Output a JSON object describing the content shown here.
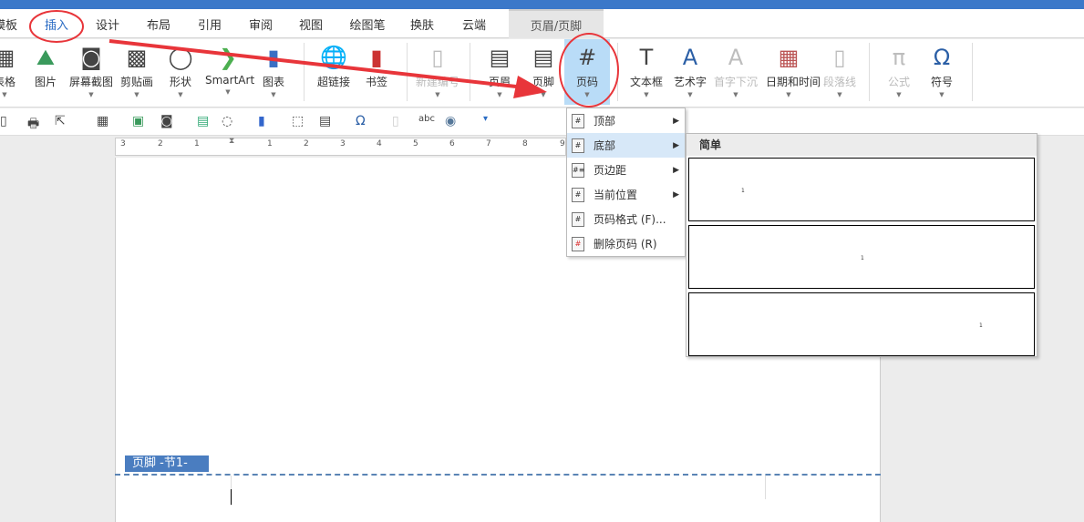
{
  "tabs": [
    "模板",
    "插入",
    "设计",
    "布局",
    "引用",
    "审阅",
    "视图",
    "绘图笔",
    "换肤",
    "云端"
  ],
  "context_tab": "页眉/页脚",
  "ribbon": [
    {
      "label": "表格",
      "icon": "table-icon"
    },
    {
      "label": "图片",
      "icon": "picture-icon"
    },
    {
      "label": "屏幕截图",
      "icon": "screenshot-icon"
    },
    {
      "label": "剪贴画",
      "icon": "clipart-icon"
    },
    {
      "label": "形状",
      "icon": "shapes-icon"
    },
    {
      "label": "SmartArt",
      "icon": "smartart-icon"
    },
    {
      "label": "图表",
      "icon": "chart-icon"
    },
    {
      "label": "超链接",
      "icon": "hyperlink-icon"
    },
    {
      "label": "书签",
      "icon": "bookmark-icon"
    },
    {
      "label": "新建编号",
      "icon": "new-number-icon",
      "disabled": true
    },
    {
      "label": "页眉",
      "icon": "header-icon"
    },
    {
      "label": "页脚",
      "icon": "footer-icon"
    },
    {
      "label": "页码",
      "icon": "page-number-icon"
    },
    {
      "label": "文本框",
      "icon": "textbox-icon"
    },
    {
      "label": "艺术字",
      "icon": "wordart-icon"
    },
    {
      "label": "首字下沉",
      "icon": "dropcap-icon",
      "disabled": true
    },
    {
      "label": "日期和时间",
      "icon": "datetime-icon"
    },
    {
      "label": "段落线",
      "icon": "paragraph-line-icon",
      "disabled": true
    },
    {
      "label": "公式",
      "icon": "formula-icon",
      "disabled": true
    },
    {
      "label": "符号",
      "icon": "symbol-icon"
    }
  ],
  "ruler_ticks": [
    "3",
    "2",
    "1",
    "1",
    "2",
    "3",
    "4",
    "5",
    "6",
    "7",
    "8",
    "9"
  ],
  "page_number_menu": [
    {
      "label": "顶部",
      "submenu": true
    },
    {
      "label": "底部",
      "submenu": true
    },
    {
      "label": "页边距",
      "submenu": true
    },
    {
      "label": "当前位置",
      "submenu": true
    },
    {
      "label": "页码格式 (F)...",
      "submenu": false
    },
    {
      "label": "删除页码 (R)",
      "submenu": false
    }
  ],
  "submenu": {
    "header": "简单",
    "options": [
      "1",
      "1",
      "1"
    ]
  },
  "footer_label": "页脚 -节1-",
  "colors": {
    "accent": "#3b78c9",
    "annotation": "#e8353a"
  }
}
